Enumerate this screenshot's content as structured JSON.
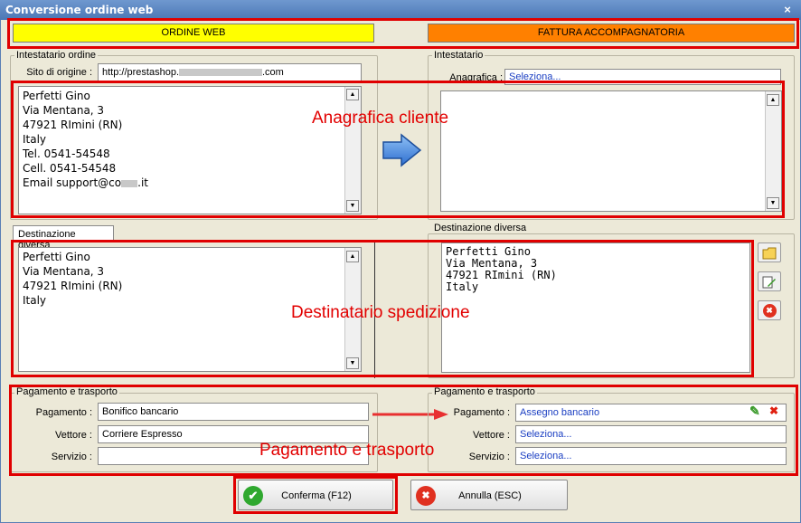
{
  "window": {
    "title": "Conversione ordine web",
    "close_glyph": "×"
  },
  "headers": {
    "left": "ORDINE WEB",
    "right": "FATTURA ACCOMPAGNATORIA",
    "left_color": "#ffff00",
    "right_color": "#ff8000"
  },
  "left": {
    "holder": {
      "legend": "Intestatario ordine",
      "origin_label": "Sito di origine :",
      "origin_value": "http://prestashop.",
      "origin_suffix": ".com",
      "address_lines": [
        "Perfetti Gino",
        "Via Mentana, 3",
        "47921 RImini (RN)",
        "Italy",
        "Tel. 0541-54548",
        "Cell. 0541-54548",
        "Email support@co",
        ".it"
      ]
    },
    "destination": {
      "tab_label": "Destinazione diversa",
      "address_lines": [
        "Perfetti Gino",
        "Via Mentana, 3",
        "47921 RImini (RN)",
        "Italy"
      ]
    },
    "payment": {
      "legend": "Pagamento e trasporto",
      "payment_label": "Pagamento :",
      "payment_value": "Bonifico bancario",
      "carrier_label": "Vettore :",
      "carrier_value": "Corriere Espresso",
      "service_label": "Servizio :",
      "service_value": ""
    }
  },
  "right": {
    "holder": {
      "legend": "Intestatario",
      "registry_label": "Anagrafica :",
      "registry_value": "Seleziona..."
    },
    "destination": {
      "legend": "Destinazione diversa",
      "address_lines": [
        "Perfetti Gino",
        "Via Mentana, 3",
        "47921 RImini (RN)",
        "Italy"
      ]
    },
    "payment": {
      "legend": "Pagamento e trasporto",
      "payment_label": "Pagamento :",
      "payment_value": "Assegno bancario",
      "carrier_label": "Vettore :",
      "carrier_value": "Seleziona...",
      "service_label": "Servizio :",
      "service_value": "Seleziona..."
    }
  },
  "annotations": {
    "customer": "Anagrafica cliente",
    "shipping": "Destinatario spedizione",
    "payment": "Pagamento e trasporto",
    "color": "#e00000"
  },
  "buttons": {
    "confirm": "Conferma (F12)",
    "cancel": "Annulla (ESC)"
  },
  "scroll": {
    "up": "▲",
    "down": "▼"
  },
  "glyphs": {
    "check": "✔",
    "cross": "✖",
    "pencil": "✎"
  },
  "icons": {
    "transfer": "arrow-right-icon",
    "folder": "folder-icon",
    "edit": "edit-icon",
    "delete": "delete-icon",
    "pencil": "pencil-icon",
    "remove": "remove-icon",
    "confirm": "check-icon",
    "cancel": "cancel-icon"
  }
}
